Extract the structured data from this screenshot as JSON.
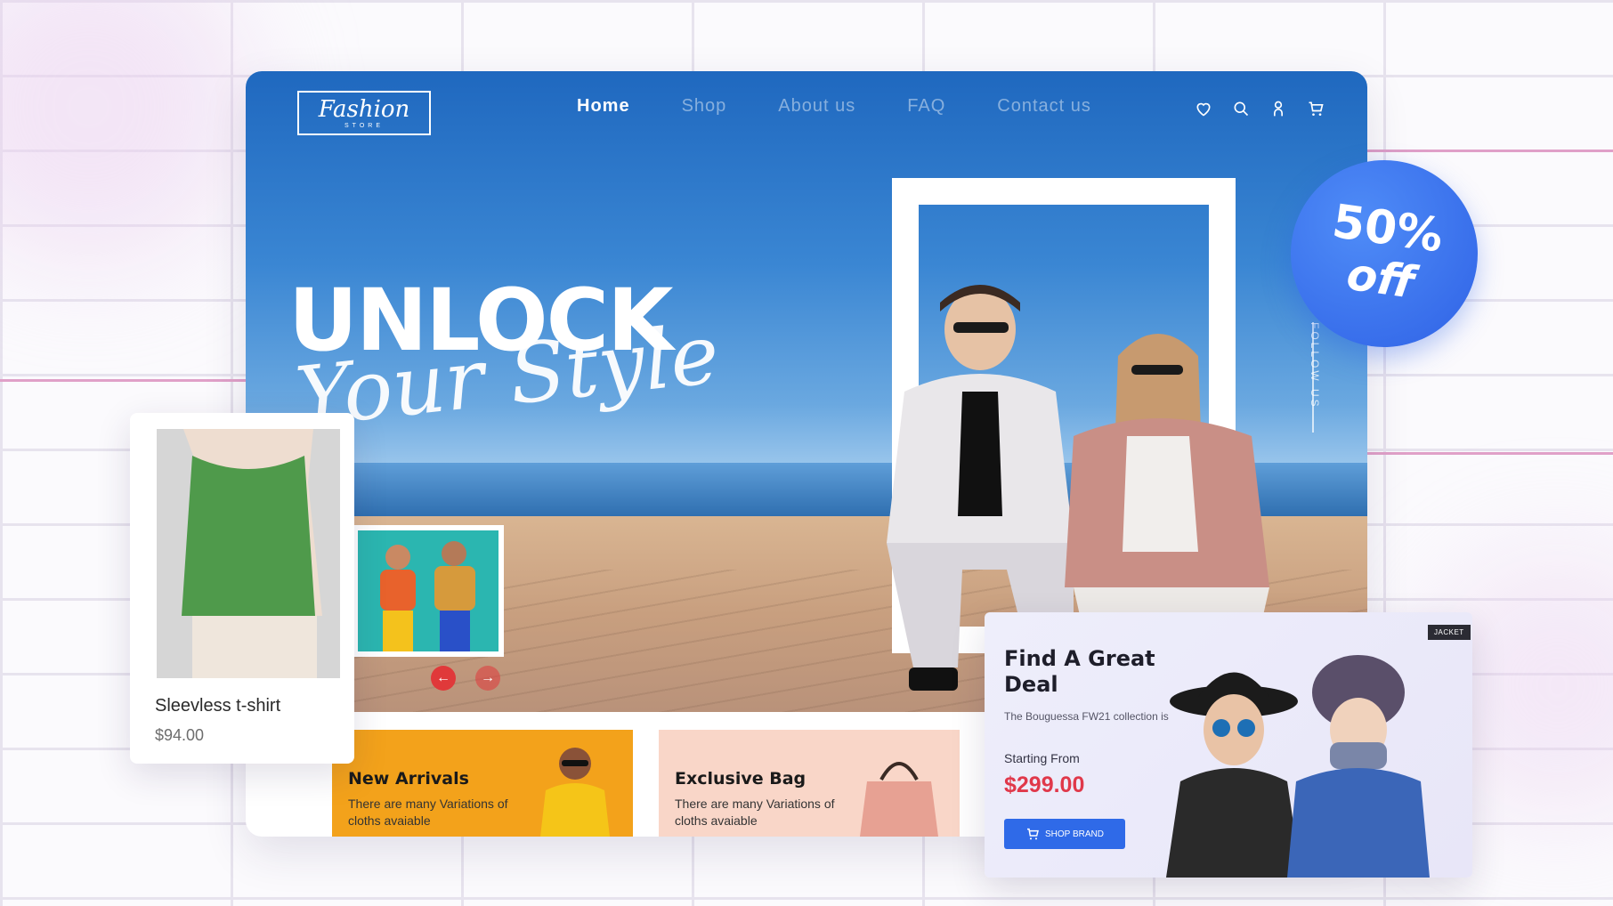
{
  "nav": {
    "logo_script": "Fashion",
    "logo_sub": "STORE",
    "items": [
      {
        "label": "Home",
        "active": true
      },
      {
        "label": "Shop"
      },
      {
        "label": "About us"
      },
      {
        "label": "FAQ"
      },
      {
        "label": "Contact us"
      }
    ],
    "icons": [
      "heart-icon",
      "search-icon",
      "user-icon",
      "cart-icon"
    ]
  },
  "hero": {
    "title": "UNLOCK",
    "script": "Your Style",
    "follow": "FOLLOW US"
  },
  "promos": [
    {
      "title": "New Arrivals",
      "text": "There are many Variations of cloths avaiable",
      "color": "#f3a21b"
    },
    {
      "title": "Exclusive Bag",
      "text": "There are many Variations of cloths avaiable",
      "color": "#f9d6c8"
    }
  ],
  "product": {
    "name": "Sleevless t-shirt",
    "price": "$94.00"
  },
  "badge": {
    "line1": "50%",
    "line2": "off"
  },
  "deal": {
    "tag": "JACKET",
    "title": "Find A Great Deal",
    "subtitle": "The Bouguessa FW21 collection is",
    "from_label": "Starting From",
    "price": "$299.00",
    "button": "SHOP BRAND"
  },
  "colors": {
    "accent_blue": "#2f6ae8",
    "price_red": "#e0384a",
    "slider_red": "#e0393a"
  }
}
